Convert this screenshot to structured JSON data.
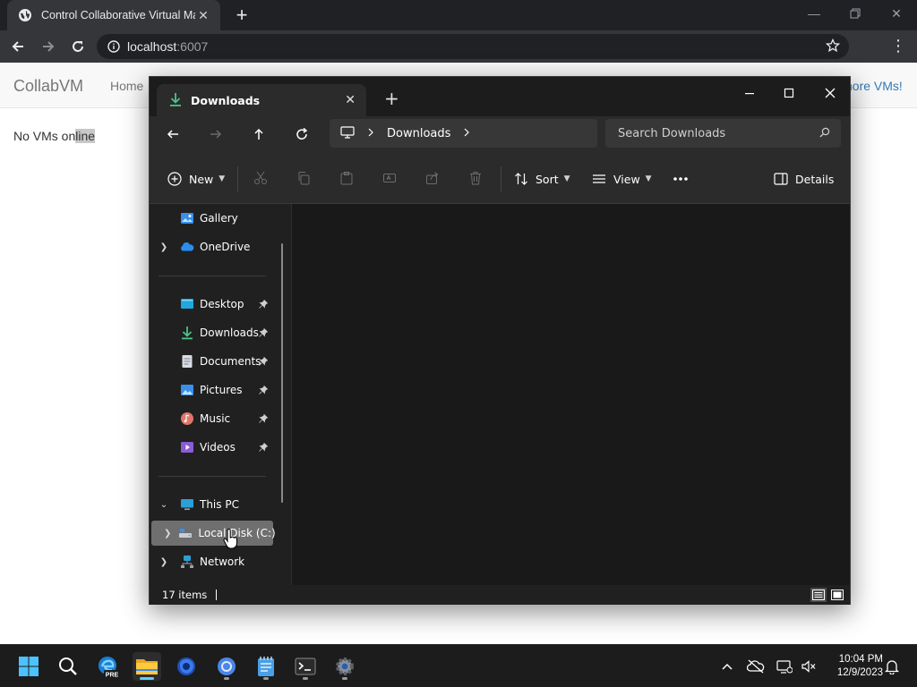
{
  "browser": {
    "tab_title": "Control Collaborative Virtual Ma",
    "url_host": "localhost",
    "url_port": ":6007"
  },
  "page": {
    "brand": "CollabVM",
    "nav_home": "Home",
    "nav_more": "nore VMs!",
    "status_prefix": "No VMs on",
    "status_highlight": "line"
  },
  "explorer": {
    "tab_title": "Downloads",
    "breadcrumb": "Downloads",
    "search_placeholder": "Search Downloads",
    "commands": {
      "new": "New",
      "sort": "Sort",
      "view": "View",
      "details": "Details"
    },
    "nav_items": [
      {
        "label": "Gallery",
        "icon": "gallery-icon",
        "expandable": false,
        "pinned": false
      },
      {
        "label": "OneDrive",
        "icon": "onedrive-icon",
        "expandable": true,
        "pinned": false
      },
      {
        "label": "Desktop",
        "icon": "desktop-folder-icon",
        "expandable": false,
        "pinned": true
      },
      {
        "label": "Downloads",
        "icon": "downloads-folder-icon",
        "expandable": false,
        "pinned": true
      },
      {
        "label": "Documents",
        "icon": "documents-folder-icon",
        "expandable": false,
        "pinned": true
      },
      {
        "label": "Pictures",
        "icon": "pictures-folder-icon",
        "expandable": false,
        "pinned": true
      },
      {
        "label": "Music",
        "icon": "music-folder-icon",
        "expandable": false,
        "pinned": true
      },
      {
        "label": "Videos",
        "icon": "videos-folder-icon",
        "expandable": false,
        "pinned": true
      },
      {
        "label": "This PC",
        "icon": "this-pc-icon",
        "expandable": true,
        "expanded": true,
        "pinned": false
      },
      {
        "label": "Local Disk (C:)",
        "icon": "local-disk-icon",
        "expandable": true,
        "pinned": false,
        "selected": true
      },
      {
        "label": "Network",
        "icon": "network-icon",
        "expandable": true,
        "pinned": false
      }
    ],
    "status": "17 items"
  },
  "taskbar": {
    "apps": [
      "start-icon",
      "search-icon",
      "edge-beta-icon",
      "file-explorer-icon",
      "firefox-icon",
      "chrome-icon",
      "notepad-icon",
      "terminal-icon",
      "settings-icon"
    ],
    "time": "10:04 PM",
    "date": "12/9/2023"
  },
  "colors": {
    "accent": "#60cdff",
    "link": "#337ab7",
    "explorer_bg": "#202020"
  }
}
